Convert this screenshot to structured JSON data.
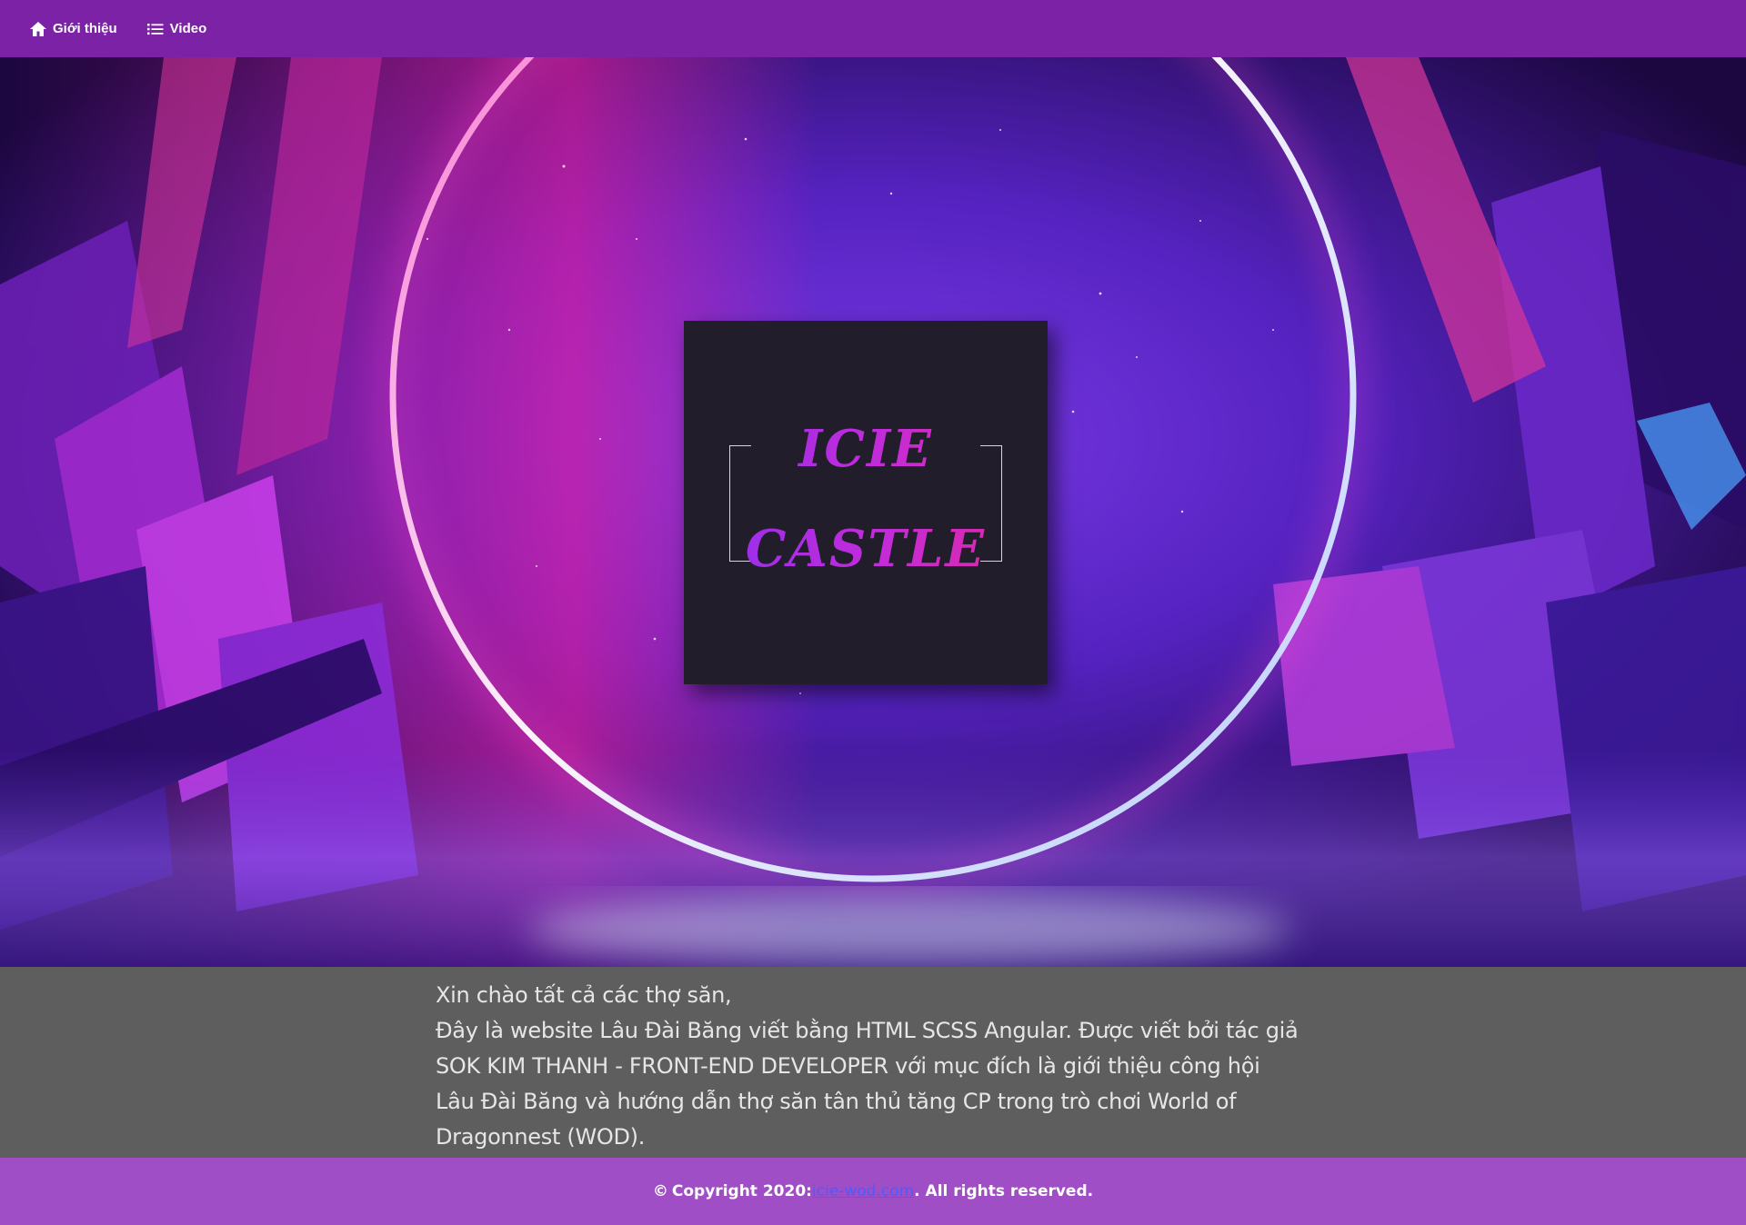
{
  "nav": {
    "items": [
      {
        "label": "Giới thiệu",
        "icon": "home-icon"
      },
      {
        "label": "Video",
        "icon": "list-icon"
      }
    ]
  },
  "logo": {
    "line1": "ICIE",
    "line2": "CASTLE"
  },
  "intro": {
    "greeting": "Xin chào tất cả các thợ săn,",
    "body": "Đây là website Lâu Đài Băng viết bằng HTML SCSS Angular. Được viết bởi tác giả SOK KIM THANH - FRONT-END DEVELOPER với mục đích là giới thiệu công hội Lâu Đài Băng và hướng dẫn thợ săn tân thủ tăng CP trong trò chơi World of Dragonnest (WOD)."
  },
  "footer": {
    "copyright_symbol": "©",
    "prefix": "Copyright 2020:",
    "link_text": "icie-wod.com",
    "suffix": ". All rights reserved."
  },
  "colors": {
    "topbar": "#7b22a7",
    "footer": "#a04ec6",
    "intro_bg": "#5e5e5e",
    "logo_card": "#211d2b",
    "logo_gradient_start": "#8e2ff0",
    "logo_gradient_end": "#e22a9a",
    "link": "#4a5cff"
  }
}
